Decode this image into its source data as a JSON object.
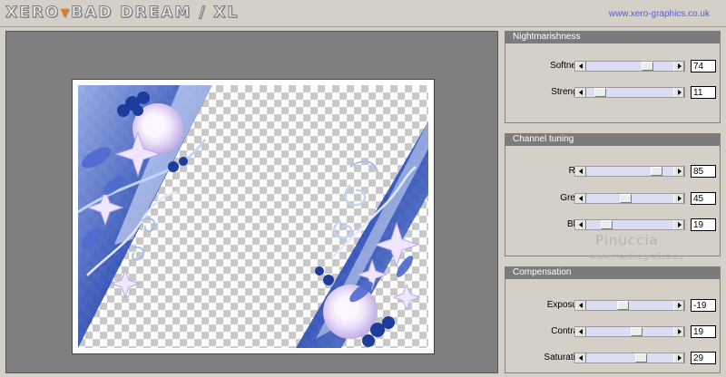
{
  "header": {
    "logo_part1": "XERO",
    "logo_part2": "BAD DREAM / XL",
    "url": "www.xero-graphics.co.uk"
  },
  "panels": [
    {
      "title": "Nightmarishness",
      "rows": [
        {
          "label": "Softness",
          "value": "74",
          "level": 0.74
        },
        {
          "label": "Strength",
          "value": "11",
          "level": 0.11
        }
      ]
    },
    {
      "title": "Channel tuning",
      "rows": [
        {
          "label": "Red",
          "value": "85",
          "level": 0.85
        },
        {
          "label": "Green",
          "value": "45",
          "level": 0.45
        },
        {
          "label": "Blue",
          "value": "19",
          "level": 0.19
        }
      ]
    },
    {
      "title": "Compensation",
      "rows": [
        {
          "label": "Exposure",
          "value": "-19",
          "level": 0.405
        },
        {
          "label": "Contrast",
          "value": "19",
          "level": 0.595
        },
        {
          "label": "Saturation",
          "value": "29",
          "level": 0.645
        }
      ]
    }
  ],
  "watermark": {
    "name": "Pinuccia",
    "site": "www.maidiregrafica.eu"
  },
  "colors": {
    "accent": "#e57b2a",
    "url": "#5a5ad8",
    "header": "#7b7b7b",
    "slider_track": "#dcdcf2",
    "flower_blue": "#2d4fb8"
  },
  "icons": [
    "left-arrow-icon",
    "right-arrow-icon"
  ]
}
